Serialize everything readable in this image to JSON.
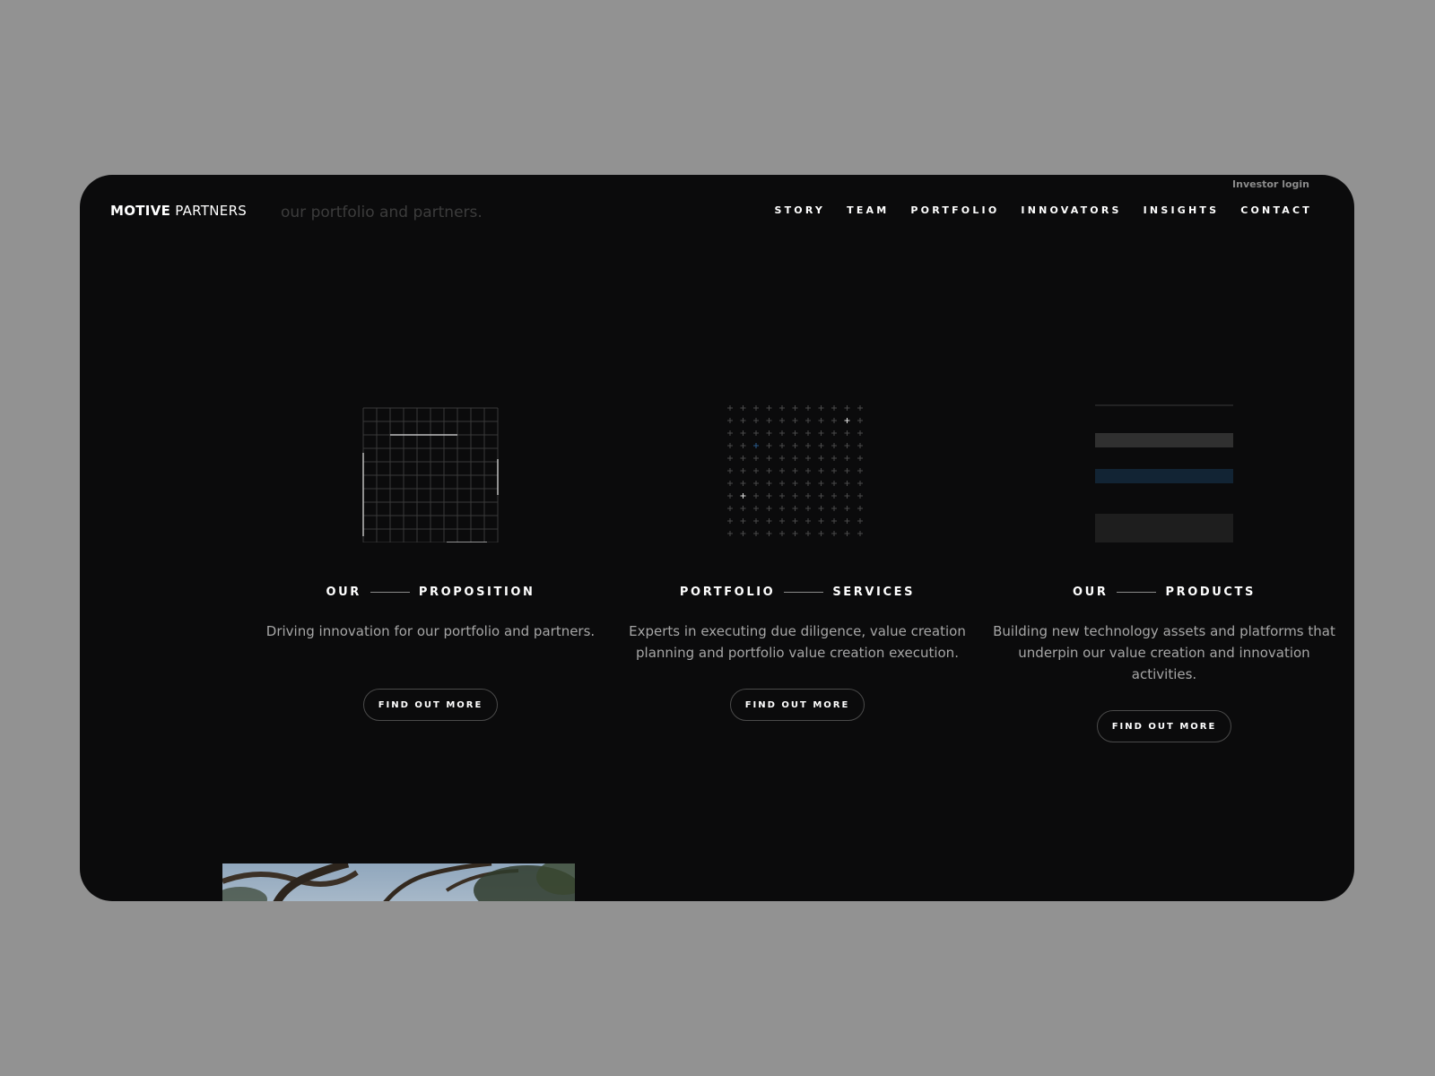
{
  "header": {
    "investor_login": "Investor login",
    "logo": {
      "strong": "MOTIVE",
      "light": "PARTNERS"
    },
    "ghost_text": "our portfolio and partners.",
    "nav": [
      {
        "label": "STORY"
      },
      {
        "label": "TEAM"
      },
      {
        "label": "PORTFOLIO"
      },
      {
        "label": "INNOVATORS"
      },
      {
        "label": "INSIGHTS"
      },
      {
        "label": "CONTACT"
      }
    ]
  },
  "cards": [
    {
      "title_left": "OUR",
      "title_right": "PROPOSITION",
      "description": "Driving innovation for our portfolio and partners.",
      "button": "FIND OUT MORE",
      "visual": "grid-icon"
    },
    {
      "title_left": "PORTFOLIO",
      "title_right": "SERVICES",
      "description": "Experts in executing due diligence, value creation planning and portfolio value creation execution.",
      "button": "FIND OUT MORE",
      "visual": "plus-grid-icon"
    },
    {
      "title_left": "OUR",
      "title_right": "PRODUCTS",
      "description": "Building new technology assets and platforms that underpin our value creation and innovation activities.",
      "button": "FIND OUT MORE",
      "visual": "stripes-icon"
    }
  ],
  "colors": {
    "background": "#0b0b0c",
    "accent_blue": "#1f4e79",
    "text_muted": "#a6a6a6"
  }
}
